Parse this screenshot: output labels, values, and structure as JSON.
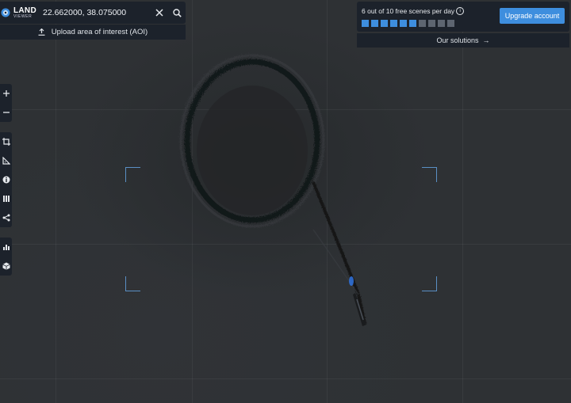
{
  "search": {
    "logo_main": "LAND",
    "logo_sub": "VIEWER",
    "coordinates": "22.662000, 38.075000",
    "clear_icon": "close-icon",
    "search_icon": "search-icon",
    "upload_label": "Upload area of interest (AOI)",
    "upload_icon": "upload-icon"
  },
  "quota": {
    "text": "6 out of 10 free scenes per day",
    "info_icon": "info-icon",
    "used": 6,
    "total": 10,
    "used_color": "#3e8ede",
    "unused_color": "#5d6570",
    "upgrade_label": "Upgrade account"
  },
  "solutions": {
    "label": "Our solutions",
    "arrow": "→"
  },
  "toolbar": {
    "group1": [
      {
        "name": "zoom-in-icon",
        "glyph": "+"
      },
      {
        "name": "zoom-out-icon",
        "glyph": "−"
      }
    ],
    "group2": [
      {
        "name": "crop-icon"
      },
      {
        "name": "measure-icon"
      },
      {
        "name": "info-icon"
      },
      {
        "name": "library-icon"
      },
      {
        "name": "share-icon"
      }
    ],
    "group3": [
      {
        "name": "analytics-icon"
      },
      {
        "name": "3d-cube-icon"
      }
    ]
  },
  "colors": {
    "panel": "#1c222b",
    "accent": "#3e8ede",
    "aoi_marker": "#5a8fc4"
  }
}
